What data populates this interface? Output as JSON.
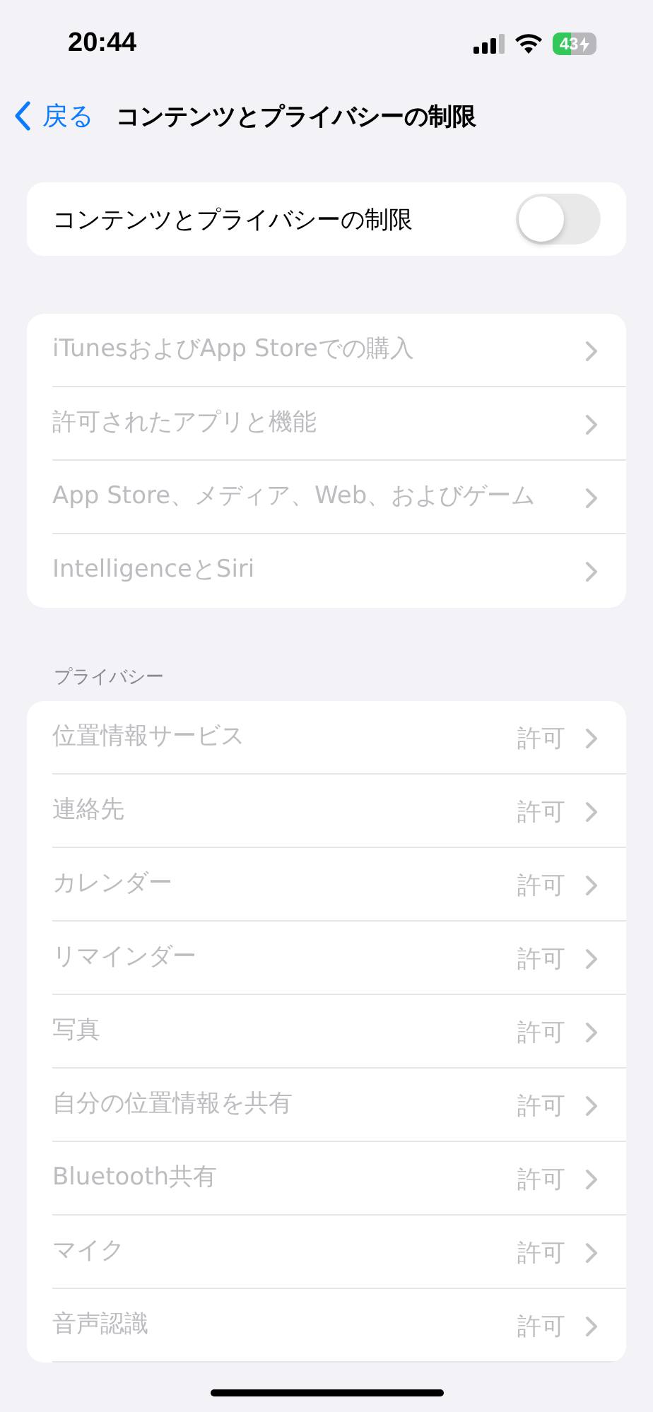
{
  "status_bar": {
    "time": "20:44",
    "battery": "43",
    "charging": true
  },
  "nav": {
    "back": "戻る",
    "title": "コンテンツとプライバシーの制限"
  },
  "main_toggle": {
    "label": "コンテンツとプライバシーの制限",
    "on": false
  },
  "store_group": [
    {
      "label": "iTunesおよびApp Storeでの購入",
      "disabled": true
    },
    {
      "label": "許可されたアプリと機能",
      "disabled": true
    },
    {
      "label": "App Store、メディア、Web、およびゲーム",
      "disabled": true
    },
    {
      "label": "IntelligenceとSiri",
      "disabled": true
    }
  ],
  "privacy": {
    "header": "プライバシー",
    "items": [
      {
        "label": "位置情報サービス",
        "value": "許可",
        "disabled": true
      },
      {
        "label": "連絡先",
        "value": "許可",
        "disabled": true
      },
      {
        "label": "カレンダー",
        "value": "許可",
        "disabled": true
      },
      {
        "label": "リマインダー",
        "value": "許可",
        "disabled": true
      },
      {
        "label": "写真",
        "value": "許可",
        "disabled": true
      },
      {
        "label": "自分の位置情報を共有",
        "value": "許可",
        "disabled": true
      },
      {
        "label": "Bluetooth共有",
        "value": "許可",
        "disabled": true
      },
      {
        "label": "マイク",
        "value": "許可",
        "disabled": true
      },
      {
        "label": "音声認識",
        "value": "許可",
        "disabled": true
      }
    ]
  }
}
